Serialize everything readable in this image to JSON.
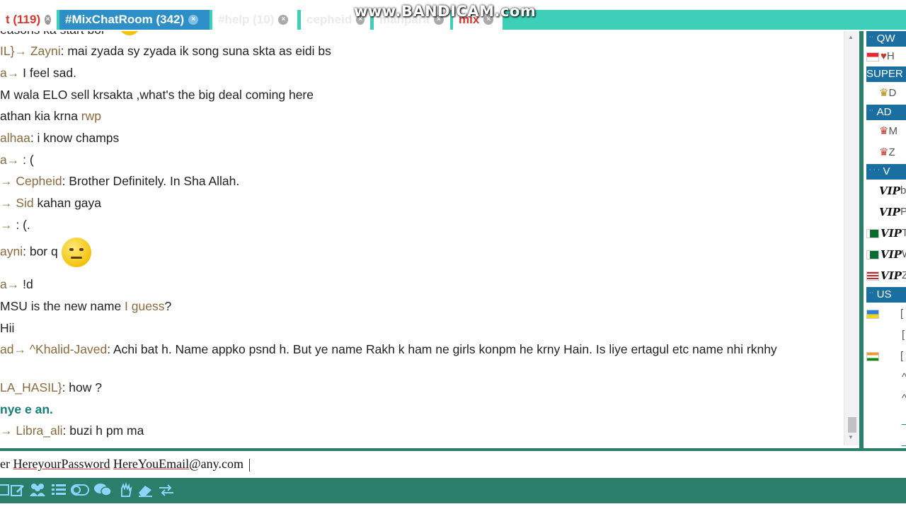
{
  "watermark": "www.BANDICAM.com",
  "tabs": [
    {
      "label": "t (119)",
      "close": "×"
    },
    {
      "label": "#MixChatRoom (342)",
      "close": "×"
    },
    {
      "label": "#help (10)",
      "close": "×"
    },
    {
      "label": "cepheid",
      "close": "×"
    },
    {
      "label": "mahpara",
      "close": "×"
    },
    {
      "label": "mix",
      "close": "×"
    }
  ],
  "messages": [
    {
      "nick": "",
      "arrow": "",
      "to": "",
      "text": "easons ka start bor"
    },
    {
      "nick": "IL}",
      "arrow": "→ ",
      "to": "Zayni",
      "text": ":  mai zyada sy zyada ik song suna skta as eidi bs"
    },
    {
      "nick": "a",
      "arrow": "→ ",
      "to": "",
      "text": "I feel sad."
    },
    {
      "nick": "",
      "arrow": "",
      "to": "",
      "text": "M wala ELO sell krsakta ,what's the big deal coming here"
    },
    {
      "nick": "",
      "arrow": "",
      "to": "",
      "text": "athan kia krna ",
      "tail": "rwp"
    },
    {
      "nick": "alhaa",
      "arrow": "",
      "to": "",
      "text": ": i know champs"
    },
    {
      "nick": "a",
      "arrow": "→ ",
      "to": "",
      "text": ": ("
    },
    {
      "nick": "",
      "arrow": "→ ",
      "to": "Cepheid",
      "text": ": Brother Definitely. In Sha Allah."
    },
    {
      "nick": "",
      "arrow": "→ ",
      "to": "Sid",
      "text": " kahan gaya"
    },
    {
      "nick": "",
      "arrow": "→ ",
      "to": "",
      "text": ": (."
    },
    {
      "nick": "ayni",
      "arrow": "",
      "to": "",
      "text": ": bor q "
    },
    {
      "nick": "a",
      "arrow": "→ ",
      "to": "",
      "text": "!d"
    },
    {
      "nick": "",
      "arrow": "",
      "to": "",
      "text": "MSU is the new name ",
      "tail": "I guess",
      "after": "?"
    },
    {
      "nick": "",
      "arrow": "",
      "to": "",
      "text": " Hii"
    },
    {
      "nick": "ad",
      "arrow": "→ ",
      "to": "^Khalid-Javed",
      "text": ": Achi bat h. Name appko psnd h. But ye name Rakh k ham ne girls konpm he krny Hain. Is liye ertagul etc name nhi rknhy"
    },
    {
      "nick": "LA_HASIL}",
      "arrow": "",
      "to": "",
      "text": ": how ?"
    },
    {
      "nick": "",
      "arrow": "",
      "to": "",
      "text": "nye e an.",
      "system": true
    },
    {
      "nick": "",
      "arrow": "→ ",
      "to": "Libra_ali",
      "text": ": buzi h pm ma"
    }
  ],
  "userlist": {
    "sections": [
      "QW",
      "SUPER",
      "AD",
      "V",
      "US"
    ],
    "rows": [
      "H",
      "D",
      "M",
      "Z",
      "b",
      "P",
      "T",
      "W",
      "Z",
      "[",
      "[",
      "[",
      "^",
      "^",
      "_",
      "_"
    ]
  },
  "input": {
    "prefix": "er ",
    "part1": "HereyourPassword",
    "sep": " ",
    "part2": "HereYouEmail",
    "suffix": "@any.com"
  },
  "toolbar_icons": [
    "edit-icon",
    "pencil-icon",
    "users-icon",
    "list-icon",
    "toggle-icon",
    "chat-bubbles-icon",
    "hand-icon",
    "eraser-icon",
    "swap-arrows-icon"
  ],
  "colors": {
    "tab_bar": "#3ecfb8",
    "active_tab": "#2e8fc7",
    "toolbar": "#2a7e6a",
    "nick": "#8a6a3c",
    "section_header": "#1b6fa0"
  }
}
